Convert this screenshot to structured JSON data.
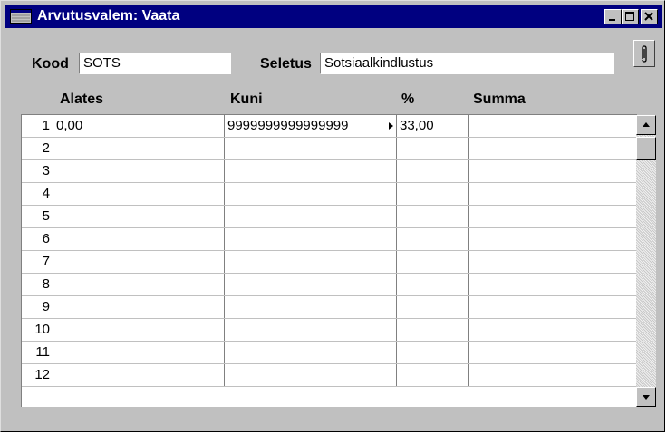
{
  "window": {
    "title": "Arvutusvalem: Vaata"
  },
  "header": {
    "kood_label": "Kood",
    "kood_value": "SOTS",
    "seletus_label": "Seletus",
    "seletus_value": "Sotsiaalkindlustus"
  },
  "table": {
    "columns": [
      "Alates",
      "Kuni",
      "%",
      "Summa"
    ],
    "rows": [
      {
        "num": "1",
        "alates": "0,00",
        "kuni": "9999999999999999",
        "pct": "33,00",
        "summa": ""
      },
      {
        "num": "2",
        "alates": "",
        "kuni": "",
        "pct": "",
        "summa": ""
      },
      {
        "num": "3",
        "alates": "",
        "kuni": "",
        "pct": "",
        "summa": ""
      },
      {
        "num": "4",
        "alates": "",
        "kuni": "",
        "pct": "",
        "summa": ""
      },
      {
        "num": "5",
        "alates": "",
        "kuni": "",
        "pct": "",
        "summa": ""
      },
      {
        "num": "6",
        "alates": "",
        "kuni": "",
        "pct": "",
        "summa": ""
      },
      {
        "num": "7",
        "alates": "",
        "kuni": "",
        "pct": "",
        "summa": ""
      },
      {
        "num": "8",
        "alates": "",
        "kuni": "",
        "pct": "",
        "summa": ""
      },
      {
        "num": "9",
        "alates": "",
        "kuni": "",
        "pct": "",
        "summa": ""
      },
      {
        "num": "10",
        "alates": "",
        "kuni": "",
        "pct": "",
        "summa": ""
      },
      {
        "num": "11",
        "alates": "",
        "kuni": "",
        "pct": "",
        "summa": ""
      },
      {
        "num": "12",
        "alates": "",
        "kuni": "",
        "pct": "",
        "summa": ""
      }
    ]
  },
  "icons": {
    "window": "window-icon",
    "minimize": "minimize-icon",
    "maximize": "maximize-icon",
    "close": "close-icon",
    "attach": "paperclip-icon",
    "overflow": "overflow-arrow-icon",
    "scroll_up": "arrow-up-icon",
    "scroll_down": "arrow-down-icon"
  },
  "colors": {
    "titlebar": "#000080",
    "window": "#c0c0c0"
  }
}
